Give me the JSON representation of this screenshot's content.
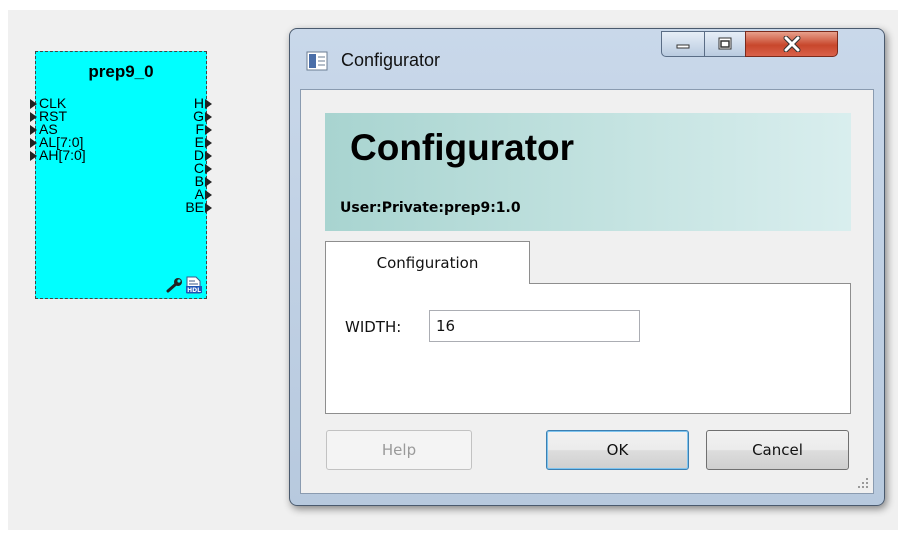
{
  "schematic": {
    "block_name": "prep9_0",
    "inputs": [
      "CLK",
      "RST",
      "AS",
      "AL[7:0]",
      "AH[7:0]"
    ],
    "outputs": [
      "H",
      "G",
      "F",
      "E",
      "D",
      "C",
      "B",
      "A",
      "BE"
    ],
    "icons": [
      "wrench-icon",
      "hdl-file-icon"
    ],
    "icon_hdl_text": "HDL",
    "fill_color": "#00ffff"
  },
  "window": {
    "title": "Configurator",
    "controls": {
      "minimize": "minimize-icon",
      "maximize": "maximize-icon",
      "close": "close-icon"
    }
  },
  "banner": {
    "title": "Configurator",
    "subtitle": "User:Private:prep9:1.0"
  },
  "tabs": [
    {
      "label": "Configuration",
      "active": true
    }
  ],
  "form": {
    "width_label": "WIDTH:",
    "width_value": "16"
  },
  "buttons": {
    "help": "Help",
    "ok": "OK",
    "cancel": "Cancel"
  },
  "colors": {
    "close_button": "#c8472c",
    "banner": "#a8d4d0",
    "ok_border": "#3c7fb1"
  }
}
